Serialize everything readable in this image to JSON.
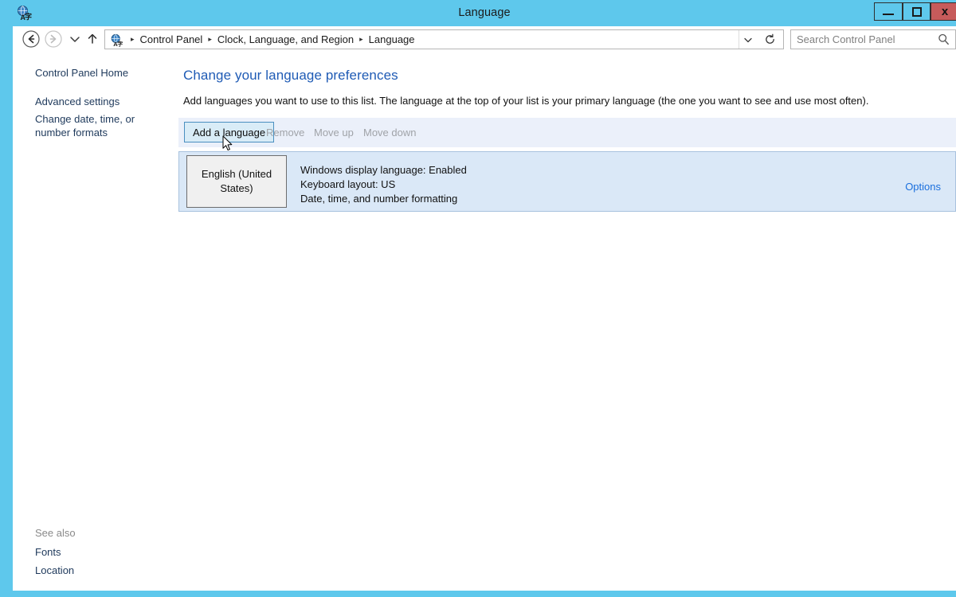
{
  "window": {
    "title": "Language",
    "icon": "language-globe-icon",
    "controls": {
      "minimize": "minimize-button",
      "maximize": "maximize-button",
      "close_label": "x"
    },
    "border_color": "#5ec8ec",
    "close_color": "#c75b5b"
  },
  "nav": {
    "back": "back-button",
    "forward": "forward-button",
    "recent": "recent-pages-button",
    "up": "up-one-level-button",
    "address_icon": "language-globe-icon",
    "breadcrumbs": [
      "Control Panel",
      "Clock, Language, and Region",
      "Language"
    ],
    "separator": "▸",
    "chevron": "⌄",
    "refresh": "↻"
  },
  "search": {
    "placeholder": "Search Control Panel",
    "value": "",
    "icon": "search-icon"
  },
  "sidebar": {
    "items": [
      {
        "label": "Control Panel Home"
      },
      {
        "label": "Advanced settings"
      },
      {
        "label": "Change date, time, or number formats"
      }
    ],
    "see_also_label": "See also",
    "see_also_items": [
      {
        "label": "Fonts"
      },
      {
        "label": "Location"
      }
    ]
  },
  "main": {
    "heading": "Change your language preferences",
    "description": "Add languages you want to use to this list. The language at the top of your list is your primary language (the one you want to see and use most often).",
    "toolbar": {
      "add_language": "Add a language",
      "remove": "Remove",
      "move_up": "Move up",
      "move_down": "Move down"
    },
    "language_list": [
      {
        "name": "English (United States)",
        "display_language": "Windows display language: Enabled",
        "keyboard_layout": "Keyboard layout: US",
        "formatting": "Date, time, and number formatting",
        "options_link": "Options"
      }
    ]
  },
  "colors": {
    "title_bar": "#5ec8ec",
    "heading_blue": "#1f5bb5",
    "link_blue": "#1a6fdd",
    "toolbar_band": "#ebf0fa",
    "list_panel": "#dae8f7",
    "button_hover": "#d9ecf7",
    "button_hover_border": "#4a8fc0",
    "disabled_text": "#a0a3a8"
  }
}
